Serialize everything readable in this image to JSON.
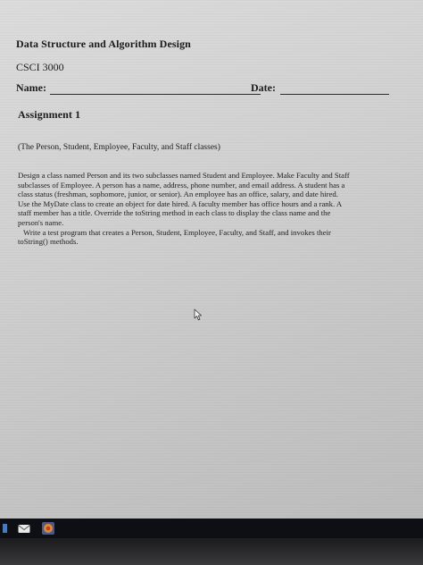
{
  "document": {
    "course_title": "Data Structure and Algorithm Design",
    "course_code": "CSCI 3000",
    "name_label": "Name:",
    "date_label": "Date:",
    "assignment": "Assignment 1",
    "subtitle": "(The Person, Student, Employee, Faculty, and Staff classes)",
    "paragraph1_lines": [
      "Design a class named Person and its two subclasses named Student and Employee. Make Faculty and Staff",
      "subclasses of Employee. A person has a name, address, phone number, and email address. A student has a",
      "class status (freshman, sophomore, junior, or senior). An employee has an office, salary, and date hired.",
      "Use the MyDate class to create an object for date hired. A faculty member has office hours and a rank. A",
      "staff member has a title. Override the toString method in each class to display the class name and the",
      "person's name."
    ],
    "paragraph2_lines": [
      "Write a test program that creates a Person, Student, Employee, Faculty, and Staff, and invokes their",
      "toString() methods."
    ]
  },
  "icons": {
    "cursor": "mouse-pointer-icon",
    "taskbar": [
      "start-icon",
      "mail-icon",
      "browser-app-icon"
    ]
  },
  "colors": {
    "screen": "#d2d2d2",
    "text": "#1b1b1b",
    "taskbar": "#0d0f14"
  }
}
